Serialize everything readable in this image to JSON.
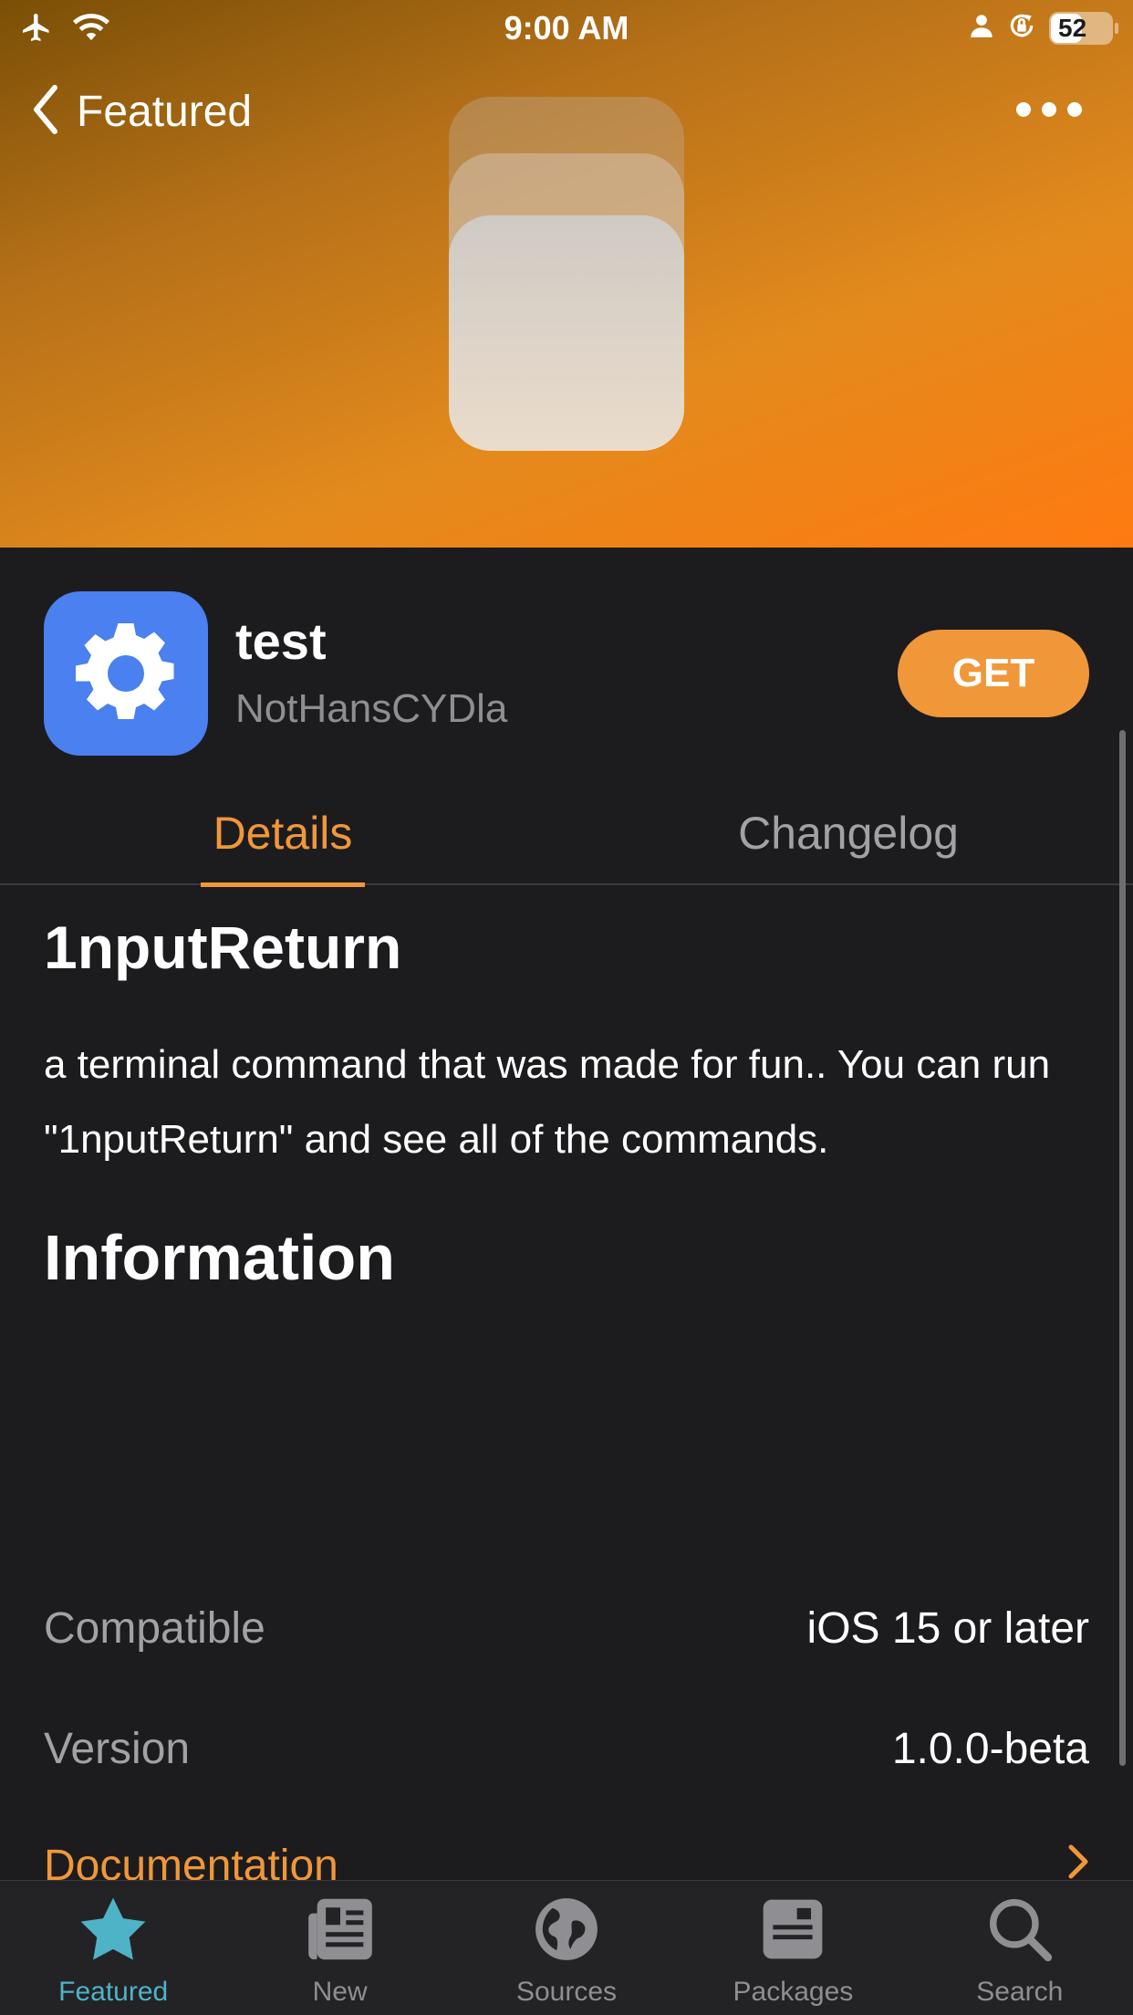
{
  "status_bar": {
    "time": "9:00 AM",
    "battery": "52"
  },
  "nav": {
    "back_label": "Featured"
  },
  "package": {
    "name": "test",
    "author": "NotHansCYDla",
    "get_label": "GET",
    "title": "1nputReturn",
    "description": "a terminal command that was made for fun.. You can run \"1nputReturn\" and see all of the commands."
  },
  "tabs": {
    "details": "Details",
    "changelog": "Changelog",
    "active": "Details"
  },
  "information": {
    "heading": "Information",
    "rows": [
      {
        "label": "Compatible",
        "value": "iOS 15 or later"
      },
      {
        "label": "Version",
        "value": "1.0.0-beta"
      },
      {
        "label": "Documentation",
        "value": ""
      }
    ]
  },
  "tabbar": {
    "active": "Featured",
    "items": [
      {
        "label": "Featured",
        "icon": "star-icon"
      },
      {
        "label": "New",
        "icon": "newspaper-icon"
      },
      {
        "label": "Sources",
        "icon": "globe-icon"
      },
      {
        "label": "Packages",
        "icon": "package-icon"
      },
      {
        "label": "Search",
        "icon": "search-icon"
      }
    ]
  },
  "colors": {
    "accent": "#f0973a",
    "tab_active": "#4fb3c8",
    "app_icon": "#4a80f0",
    "background": "#1c1c1e"
  }
}
